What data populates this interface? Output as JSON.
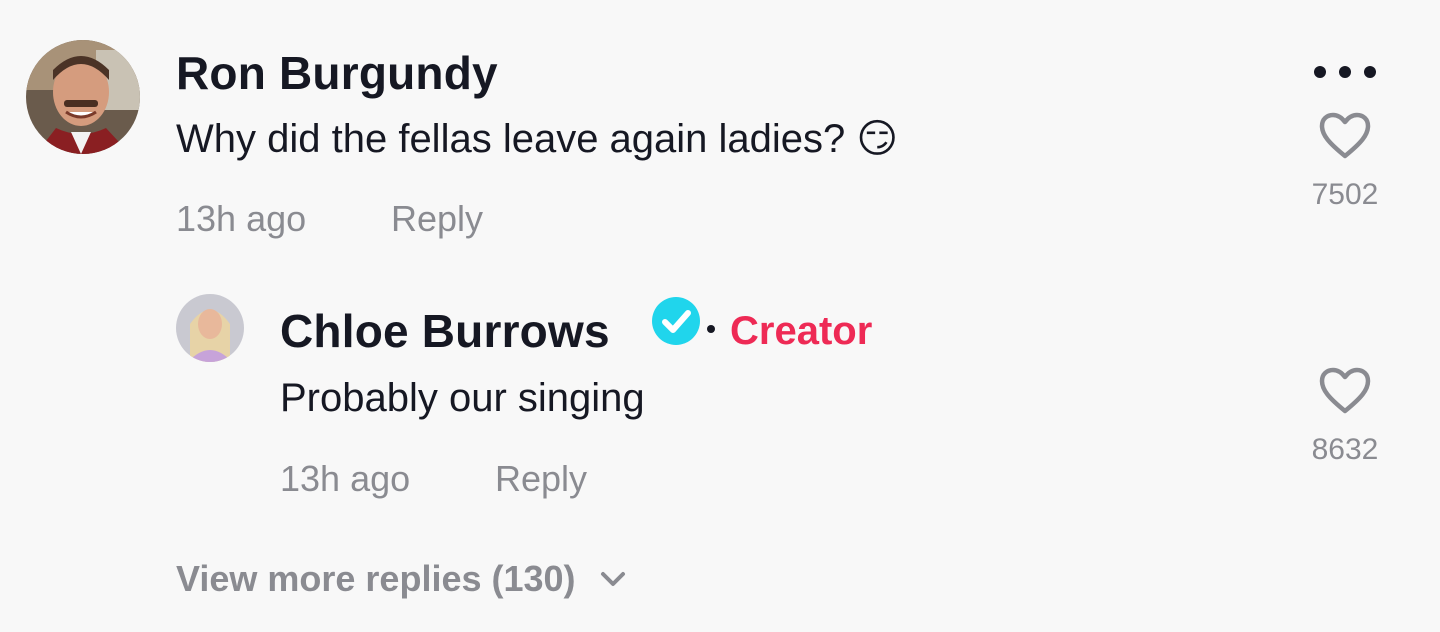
{
  "comment": {
    "username": "Ron Burgundy",
    "text": "Why did the fellas leave again ladies? 😏",
    "time": "13h ago",
    "reply_label": "Reply",
    "likes": "7502",
    "more_icon": "more-horizontal-icon",
    "like_icon": "heart-outline-icon"
  },
  "reply": {
    "username": "Chloe Burrows",
    "verified_icon": "verified-badge-icon",
    "creator_label": "Creator",
    "text": "Probably our singing",
    "time": "13h ago",
    "reply_label": "Reply",
    "likes": "8632",
    "like_icon": "heart-outline-icon"
  },
  "view_more": {
    "label": "View more replies (130)",
    "icon": "chevron-down-icon"
  },
  "colors": {
    "background": "#f8f8f8",
    "text_primary": "#161823",
    "text_secondary": "#8a8b91",
    "creator_accent": "#ee2a55",
    "verified_badge": "#20d5ec"
  }
}
